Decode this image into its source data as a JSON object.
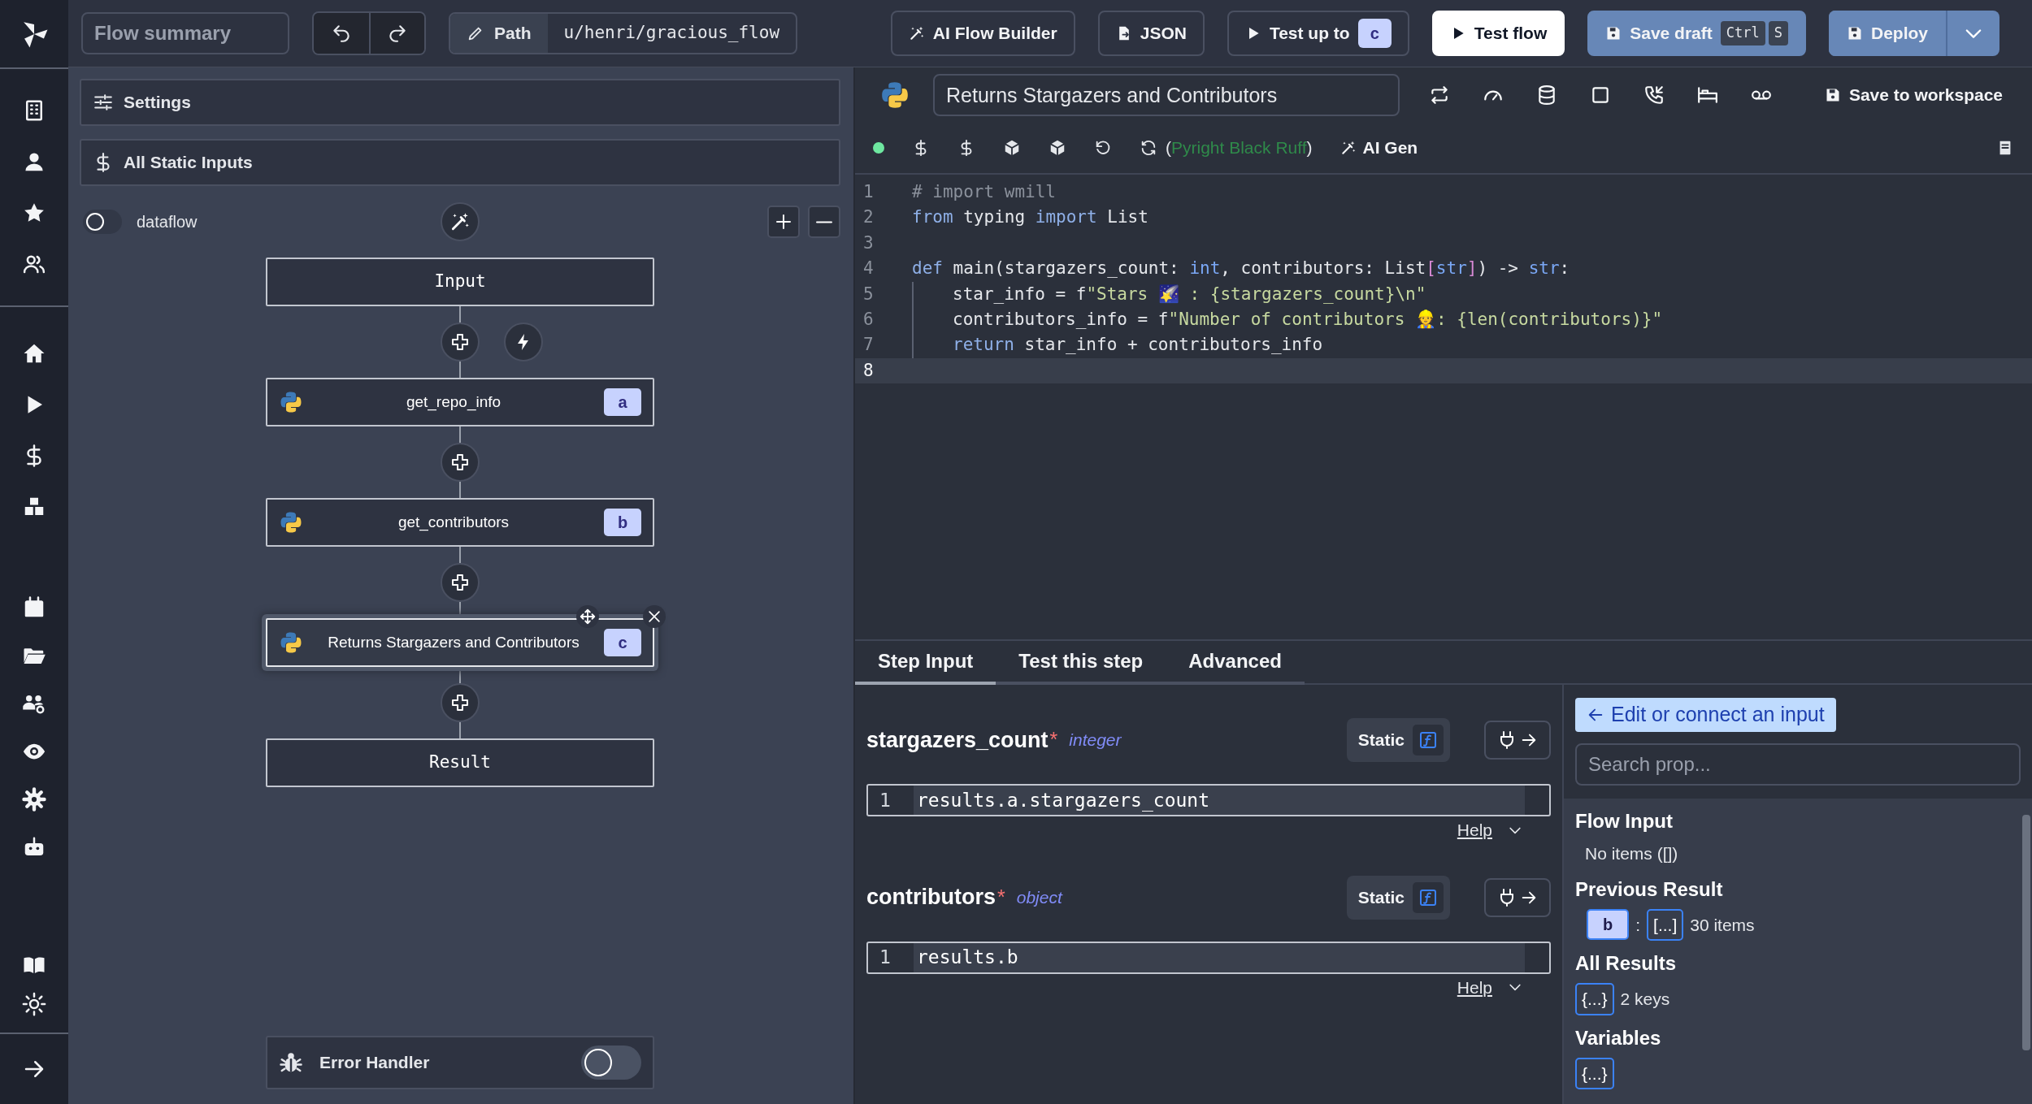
{
  "top_bar": {
    "summary_placeholder": "Flow summary",
    "path_label": "Path",
    "path": "u/henri/gracious_flow",
    "buttons": [
      {
        "kind": "outline",
        "label": "AI Flow Builder"
      },
      {
        "kind": "outline",
        "label": "JSON"
      },
      {
        "kind": "outline",
        "label": "Test up to",
        "badge": "c"
      },
      {
        "kind": "light",
        "label": "Test flow"
      },
      {
        "kind": "blue",
        "label": "Save draft",
        "keys": [
          "Ctrl",
          "S"
        ]
      },
      {
        "kind": "blue-split",
        "label": "Deploy"
      }
    ]
  },
  "flow_panel": {
    "settings": "Settings",
    "static_inputs": "All Static Inputs",
    "dataflow": {
      "label": "dataflow",
      "on": false
    },
    "nodes": [
      {
        "kind": "io",
        "label": "Input"
      },
      {
        "kind": "step",
        "label": "get_repo_info",
        "badge": "a",
        "selected": false
      },
      {
        "kind": "step",
        "label": "get_contributors",
        "badge": "b",
        "selected": false
      },
      {
        "kind": "step",
        "label": "Returns Stargazers and Contributors",
        "badge": "c",
        "selected": true
      },
      {
        "kind": "io",
        "label": "Result"
      }
    ],
    "error_handler": {
      "label": "Error Handler",
      "on": false
    }
  },
  "editor": {
    "summary": "Returns Stargazers and Contributors",
    "save_label": "Save to workspace",
    "lint": {
      "open": "(",
      "tools": "Pyright Black Ruff",
      "close": ")"
    },
    "ai_gen": "AI Gen",
    "lines": [
      {
        "n": "1",
        "selected": false,
        "tokens": [
          {
            "kind": "comment",
            "text": "# import wmill"
          }
        ]
      },
      {
        "n": "2",
        "selected": false,
        "tokens": [
          {
            "kind": "keyword",
            "text": "from"
          },
          {
            "kind": "plain",
            "text": " typing "
          },
          {
            "kind": "keyword",
            "text": "import"
          },
          {
            "kind": "plain",
            "text": " List"
          }
        ]
      },
      {
        "n": "3",
        "selected": false
      },
      {
        "n": "4",
        "selected": false,
        "tokens": [
          {
            "kind": "keyword",
            "text": "def"
          },
          {
            "kind": "plain",
            "text": " main(stargazers_count: "
          },
          {
            "kind": "type",
            "text": "int"
          },
          {
            "kind": "plain",
            "text": ", contributors: List"
          },
          {
            "kind": "bracket",
            "text": "["
          },
          {
            "kind": "type",
            "text": "str"
          },
          {
            "kind": "bracket",
            "text": "]"
          },
          {
            "kind": "plain",
            "text": ") -> "
          },
          {
            "kind": "type",
            "text": "str"
          },
          {
            "kind": "plain",
            "text": ":"
          }
        ]
      },
      {
        "n": "5",
        "selected": false,
        "indented": true,
        "tokens": [
          {
            "kind": "plain",
            "text": "star_info = f"
          },
          {
            "kind": "string",
            "text": "\"Stars 🌠 : {stargazers_count}\\n\""
          }
        ]
      },
      {
        "n": "6",
        "selected": false,
        "indented": true,
        "tokens": [
          {
            "kind": "plain",
            "text": "contributors_info = f"
          },
          {
            "kind": "string",
            "text": "\"Number of contributors 👷: {len(contributors)}\""
          }
        ]
      },
      {
        "n": "7",
        "selected": false,
        "indented": true,
        "tokens": [
          {
            "kind": "keyword",
            "text": "return"
          },
          {
            "kind": "plain",
            "text": " star_info + contributors_info"
          }
        ]
      },
      {
        "n": "8",
        "selected": true
      }
    ]
  },
  "step_tabs": [
    {
      "label": "Step Input",
      "selected": true
    },
    {
      "label": "Test this step",
      "selected": false
    },
    {
      "label": "Advanced",
      "selected": false
    }
  ],
  "inputs": [
    {
      "name": "stargazers_count",
      "required_mark": "*",
      "type": "integer",
      "mode": "Static",
      "line": "1",
      "value": "results.a.stargazers_count",
      "help": "Help"
    },
    {
      "name": "contributors",
      "required_mark": "*",
      "type": "object",
      "mode": "Static",
      "line": "1",
      "value": "results.b",
      "help": "Help"
    }
  ],
  "connect_panel": {
    "button": "Edit or connect an input",
    "search_placeholder": "Search prop...",
    "sections": [
      {
        "kind": "empty",
        "title": "Flow Input",
        "text": "No items ([])"
      },
      {
        "kind": "result",
        "title": "Previous Result",
        "badge": "b",
        "separator": ":",
        "chip": "[...]",
        "count": "30 items"
      },
      {
        "kind": "object",
        "title": "All Results",
        "chip": "{...}",
        "count": "2 keys"
      },
      {
        "kind": "object",
        "title": "Variables",
        "chip": "{...}"
      }
    ]
  }
}
